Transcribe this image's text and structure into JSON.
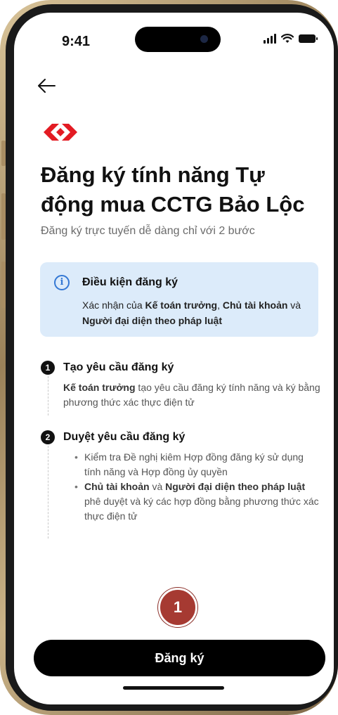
{
  "status_bar": {
    "time": "9:41"
  },
  "header": {
    "back_icon": "arrow-left-icon"
  },
  "brand": {
    "logo_colors": [
      "#e31b23"
    ]
  },
  "page": {
    "title": "Đăng ký tính năng Tự động mua CCTG Bảo Lộc",
    "subtitle": "Đăng ký trực tuyến dễ dàng chỉ với 2 bước"
  },
  "info_box": {
    "icon_letter": "i",
    "title": "Điều kiện đăng ký",
    "text_prefix": "Xác nhận của ",
    "role_1": "Kế toán trưởng",
    "sep_1": ", ",
    "role_2": "Chủ tài khoản",
    "sep_2": " và ",
    "role_3": "Người đại diện theo pháp luật",
    "bg_color": "#dcebfa",
    "accent_color": "#3478d4"
  },
  "steps": [
    {
      "number": "1",
      "title": "Tạo yêu cầu đăng ký",
      "desc_bold": "Kế toán trưởng",
      "desc_rest": " tạo yêu cầu đăng ký tính năng và ký bằng phương thức xác thực điện tử"
    },
    {
      "number": "2",
      "title": "Duyệt yêu cầu đăng ký",
      "bullet_1": "Kiểm tra Đề nghị kiêm Hợp đồng đăng ký sử dụng tính năng và Hợp đồng ủy quyền",
      "bullet_2_bold_1": "Chủ tài khoản",
      "bullet_2_mid": " và ",
      "bullet_2_bold_2": "Người đại diện theo pháp luật",
      "bullet_2_rest": " phê duyệt và ký các hợp đồng bằng phương thức xác thực điện tử"
    }
  ],
  "marker": {
    "label": "1",
    "color": "#a63a32"
  },
  "footer": {
    "primary_button": "Đăng ký"
  }
}
